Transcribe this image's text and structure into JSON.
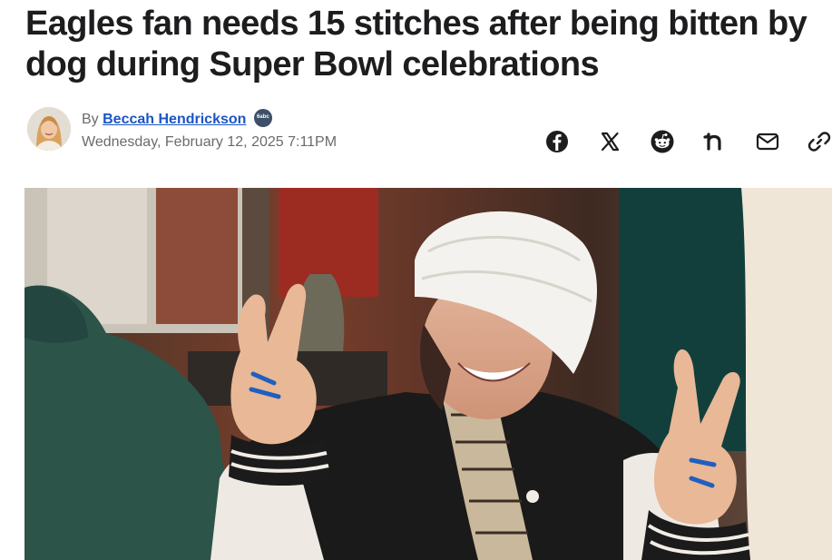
{
  "article": {
    "headline": "Eagles fan needs 15 stitches after being bitten by dog during Super Bowl celebrations",
    "byline": {
      "prefix": "By",
      "author": "Beccah Hendrickson",
      "network_badge": "6abc",
      "date": "Wednesday, February 12, 2025 7:11PM"
    }
  },
  "share": {
    "icons": [
      "facebook-icon",
      "x-icon",
      "reddit-icon",
      "nextdoor-icon",
      "email-icon",
      "copy-link-icon"
    ]
  },
  "colors": {
    "text": "#1d1d1f",
    "meta": "#6b6b6b",
    "link": "#1a55c4"
  }
}
